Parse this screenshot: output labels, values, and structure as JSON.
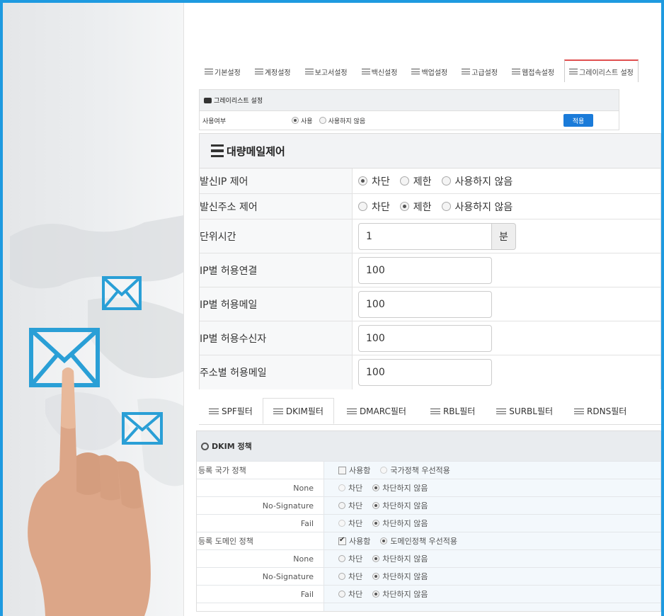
{
  "top_tabs": [
    {
      "label": "기본설정",
      "active": false
    },
    {
      "label": "계정설정",
      "active": false
    },
    {
      "label": "보고서설정",
      "active": false
    },
    {
      "label": "백신설정",
      "active": false
    },
    {
      "label": "백업설정",
      "active": false
    },
    {
      "label": "고급설정",
      "active": false
    },
    {
      "label": "웹접속설정",
      "active": false
    },
    {
      "label": "그레이리스트 설정",
      "active": true
    }
  ],
  "greylist": {
    "title": "그레이리스트 설정",
    "use_label": "사용여부",
    "opt_use": "사용",
    "opt_not_use": "사용하지 않음",
    "apply_label": "적용"
  },
  "bulk": {
    "title": "대량메일제어",
    "rows": [
      {
        "label": "발신IP 제어",
        "options": [
          "차단",
          "제한",
          "사용하지 않음"
        ],
        "selected": 0
      },
      {
        "label": "발신주소 제어",
        "options": [
          "차단",
          "제한",
          "사용하지 않음"
        ],
        "selected": 1
      }
    ],
    "unit_time": {
      "label": "단위시간",
      "value": "1",
      "unit": "분"
    },
    "inputs": [
      {
        "label": "IP별 허용연결",
        "value": "100"
      },
      {
        "label": "IP별 허용메일",
        "value": "100"
      },
      {
        "label": "IP별 허용수신자",
        "value": "100"
      },
      {
        "label": "주소별 허용메일",
        "value": "100"
      }
    ]
  },
  "filter_tabs": [
    {
      "label": "SPF필터",
      "active": false
    },
    {
      "label": "DKIM필터",
      "active": true
    },
    {
      "label": "DMARC필터",
      "active": false
    },
    {
      "label": "RBL필터",
      "active": false
    },
    {
      "label": "SURBL필터",
      "active": false
    },
    {
      "label": "RDNS필터",
      "active": false
    }
  ],
  "dkim": {
    "title": "DKIM 정책",
    "country_policy": {
      "label": "등록 국가 정책",
      "check_label": "사용함",
      "checked": false,
      "radio_label": "국가정책 우선적용"
    },
    "domain_policy": {
      "label": "등록 도메인 정책",
      "check_label": "사용함",
      "checked": true,
      "radio_label": "도메인정책 우선적용"
    },
    "block": "차단",
    "no_block": "차단하지 않음",
    "sub_labels": [
      "None",
      "No-Signature",
      "Fail"
    ]
  }
}
